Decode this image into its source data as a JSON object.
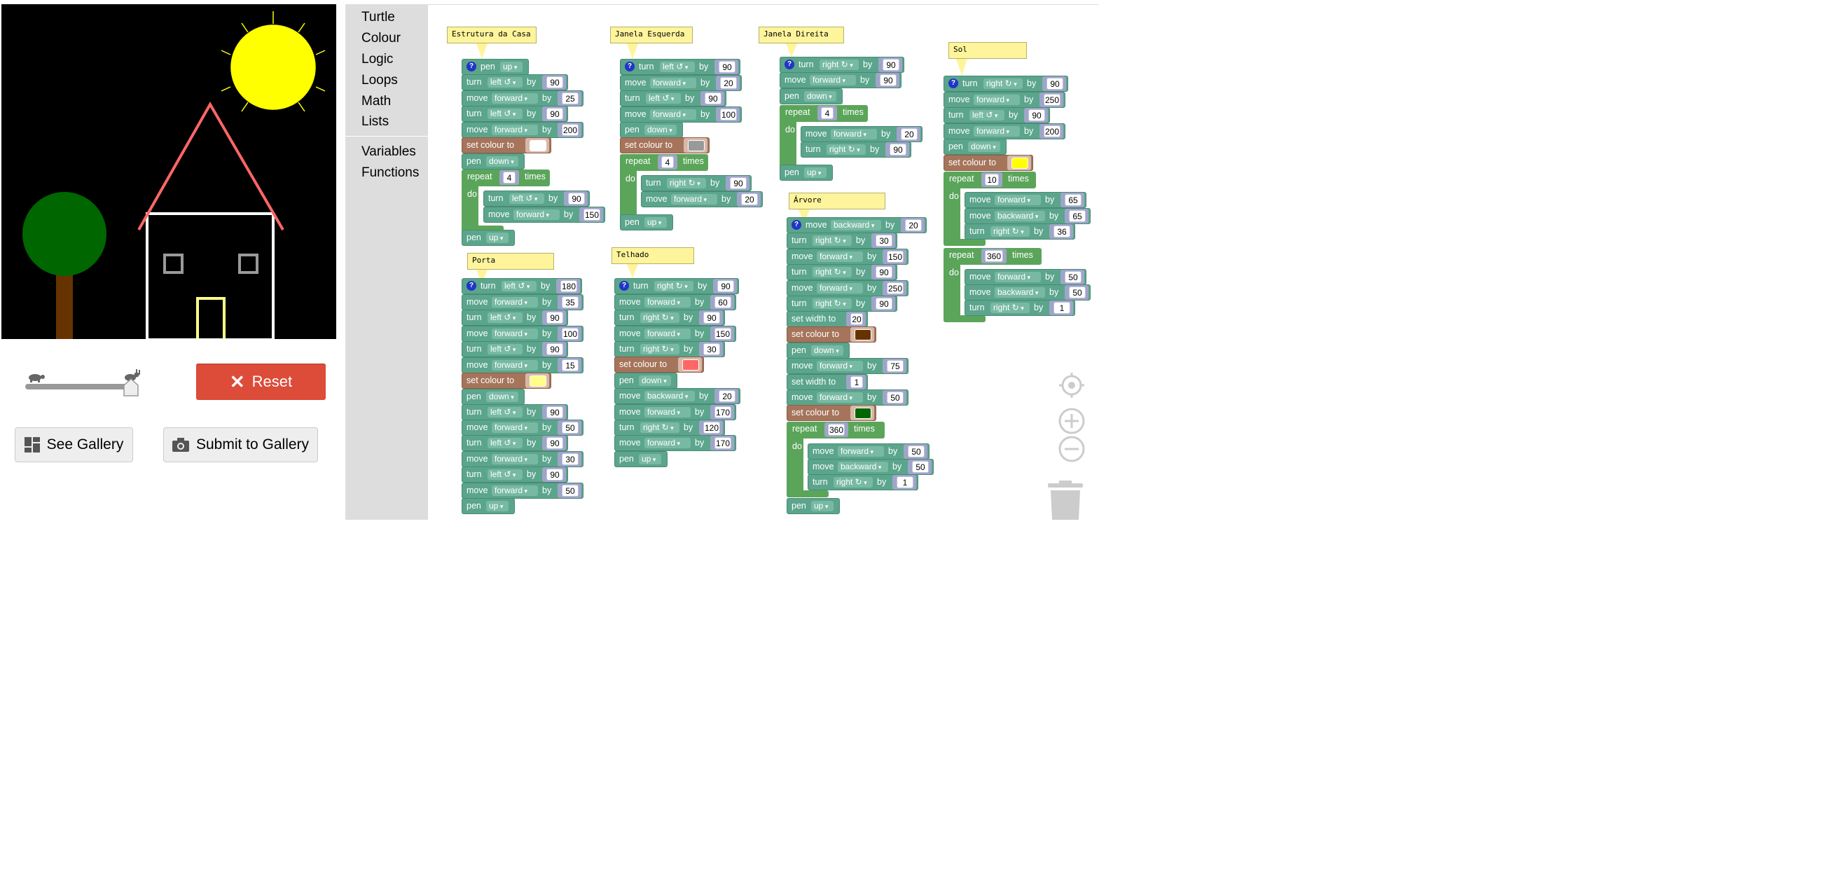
{
  "controls": {
    "reset_label": "Reset",
    "see_gallery": "See Gallery",
    "submit_gallery": "Submit to Gallery"
  },
  "toolbox": {
    "items": [
      "Turtle",
      "Colour",
      "Logic",
      "Loops",
      "Math",
      "Lists",
      "Variables",
      "Functions"
    ]
  },
  "words": {
    "turn": "turn",
    "move": "move",
    "by": "by",
    "pen": "pen",
    "set_colour": "set colour to",
    "set_width": "set width to",
    "repeat": "repeat",
    "times": "times",
    "do": "do",
    "up": "up",
    "down": "down",
    "left": "left ↺",
    "right": "right ↻",
    "forward": "forward",
    "backward": "backward",
    "q": "?"
  },
  "colors": {
    "white": "#ffffff",
    "gray": "#999999",
    "yellow": "#ffff00",
    "lightyellow": "#ffff88",
    "salmon": "#ff6666",
    "brown": "#663300",
    "green": "#006600"
  },
  "comments": {
    "estrutura": "Estrutura da Casa",
    "porta": "Porta",
    "janela_esq": "Janela Esquerda",
    "telhado": "Telhado",
    "janela_dir": "Janela Direita",
    "arvore": "Árvore",
    "sol": "Sol"
  },
  "values": {
    "e1": "90",
    "e2": "25",
    "e3": "90",
    "e4": "200",
    "e5": "4",
    "e6": "90",
    "e7": "150",
    "p1": "180",
    "p2": "35",
    "p3": "90",
    "p4": "100",
    "p5": "90",
    "p6": "15",
    "p7": "90",
    "p8": "50",
    "p9": "90",
    "p10": "30",
    "p11": "90",
    "p12": "50",
    "j1": "90",
    "j2": "20",
    "j3": "90",
    "j4": "100",
    "j5": "4",
    "j6": "90",
    "j7": "20",
    "t1": "90",
    "t2": "60",
    "t3": "90",
    "t4": "150",
    "t5": "30",
    "t6": "20",
    "t7": "170",
    "t8": "120",
    "t9": "170",
    "d1": "90",
    "d2": "90",
    "d3": "4",
    "d4": "20",
    "d5": "90",
    "a1": "20",
    "a2": "30",
    "a3": "150",
    "a4": "90",
    "a5": "250",
    "a6": "90",
    "a7": "20",
    "a8": "75",
    "a9": "1",
    "a10": "50",
    "a11": "360",
    "a12": "50",
    "a13": "50",
    "a14": "1",
    "s1": "90",
    "s2": "250",
    "s3": "90",
    "s4": "200",
    "s5": "10",
    "s6": "65",
    "s7": "65",
    "s8": "36",
    "s9": "360",
    "s10": "50",
    "s11": "50",
    "s12": "1"
  }
}
